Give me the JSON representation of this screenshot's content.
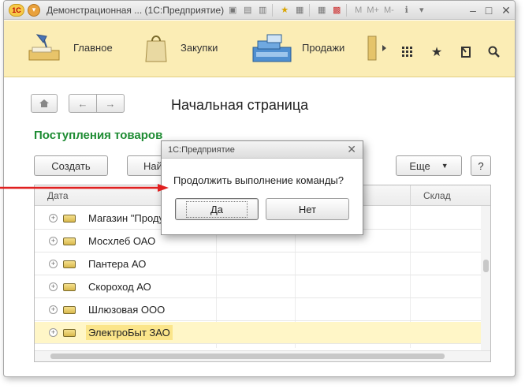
{
  "window": {
    "app_logo": "1С",
    "title": "Демонстрационная ... (1С:Предприятие)",
    "toolbar_m": "M",
    "toolbar_mplus": "M+",
    "toolbar_mminus": "M-",
    "minimize": "–",
    "maximize": "□",
    "close": "✕"
  },
  "sections": {
    "items": [
      {
        "label": "Главное",
        "icon": "desk-lamp-icon"
      },
      {
        "label": "Закупки",
        "icon": "shopping-bag-icon"
      },
      {
        "label": "Продажи",
        "icon": "cash-register-icon"
      }
    ],
    "more_icon": "chevron-right-icon",
    "tools": [
      "grid-icon",
      "star-icon",
      "history-icon",
      "search-icon"
    ]
  },
  "content": {
    "page_title": "Начальная страница",
    "list_title": "Поступления товаров",
    "create_label": "Создать",
    "find_label": "Найти...",
    "more_label": "Еще",
    "help_label": "?",
    "columns": [
      "Дата",
      "",
      "Склад"
    ],
    "rows": [
      {
        "name": "Магазин \"Продукты\"",
        "selected": false
      },
      {
        "name": "Мосхлеб ОАО",
        "selected": false
      },
      {
        "name": "Пантера АО",
        "selected": false
      },
      {
        "name": "Скороход АО",
        "selected": false
      },
      {
        "name": "Шлюзовая ООО",
        "selected": false
      },
      {
        "name": "ЭлектроБыт ЗАО",
        "selected": true
      }
    ]
  },
  "dialog": {
    "title": "1С:Предприятие",
    "message": "Продолжить выполнение команды?",
    "yes_label": "Да",
    "no_label": "Нет"
  },
  "colors": {
    "sections_bg": "#fbedb5",
    "list_title": "#1e8c33",
    "selected_row": "#fff6c7",
    "arrow": "#e02020"
  }
}
